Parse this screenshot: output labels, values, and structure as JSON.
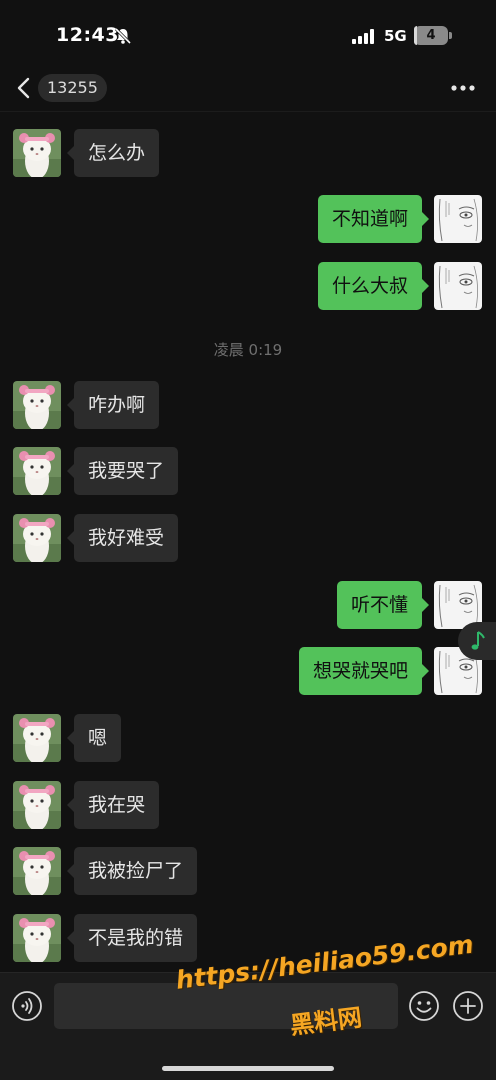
{
  "status_bar": {
    "time": "12:43",
    "network": "5G",
    "battery_level": "4",
    "battery_fraction": 0.04
  },
  "header": {
    "contact": "13255",
    "back_icon": "chevron-left-icon",
    "more_icon": "more-dots-icon"
  },
  "timestamp": "凌晨 0:19",
  "messages": [
    {
      "side": "in",
      "text": "怎么办"
    },
    {
      "side": "out",
      "text": "不知道啊"
    },
    {
      "side": "out",
      "text": "什么大叔"
    },
    {
      "side": "in",
      "text": "咋办啊"
    },
    {
      "side": "in",
      "text": "我要哭了"
    },
    {
      "side": "in",
      "text": "我好难受"
    },
    {
      "side": "out",
      "text": "听不懂"
    },
    {
      "side": "out",
      "text": "想哭就哭吧"
    },
    {
      "side": "in",
      "text": "嗯"
    },
    {
      "side": "in",
      "text": "我在哭"
    },
    {
      "side": "in",
      "text": "我被捡尸了"
    },
    {
      "side": "in",
      "text": "不是我的错"
    }
  ],
  "input_bar": {
    "placeholder": "",
    "voice_icon": "voice-icon",
    "emoji_icon": "emoji-icon",
    "add_icon": "plus-circle-icon"
  },
  "watermark": {
    "url": "https://heiliao59.com",
    "name": "黑料网"
  },
  "colors": {
    "background": "#111111",
    "outgoing_bubble": "#53c25a",
    "incoming_bubble": "#2c2c2c",
    "watermark": "#f5a623"
  }
}
